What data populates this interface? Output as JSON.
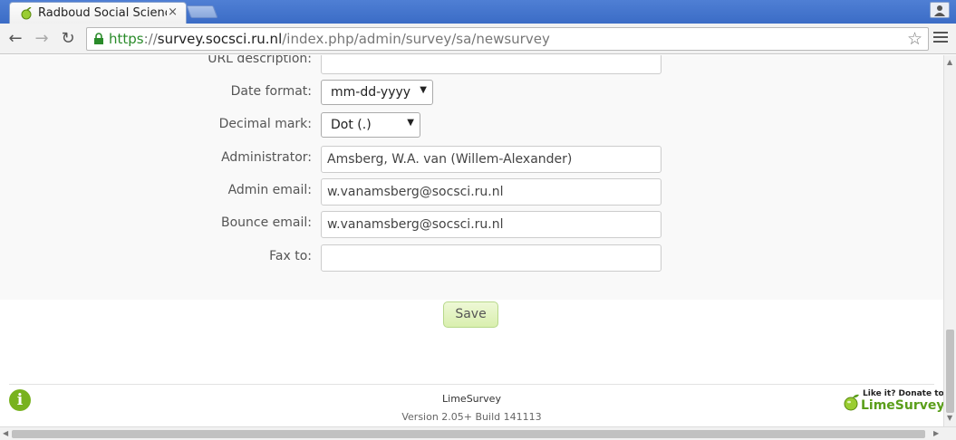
{
  "browser": {
    "tab_title": "Radboud Social Science",
    "tab_close": "×",
    "url_scheme": "https",
    "url_sep": "://",
    "url_host": "survey.socsci.ru.nl",
    "url_path": "/index.php/admin/survey/sa/newsurvey",
    "back_icon": "←",
    "forward_icon": "→",
    "reload_icon": "↻",
    "star_icon": "☆"
  },
  "form": {
    "url_description": {
      "label": "URL description:",
      "value": ""
    },
    "date_format": {
      "label": "Date format:",
      "value": "mm-dd-yyyy"
    },
    "decimal_mark": {
      "label": "Decimal mark:",
      "value": "Dot (.)"
    },
    "administrator": {
      "label": "Administrator:",
      "value": "Amsberg, W.A. van (Willem-Alexander)"
    },
    "admin_email": {
      "label": "Admin email:",
      "value": "w.vanamsberg@socsci.ru.nl"
    },
    "bounce_email": {
      "label": "Bounce email:",
      "value": "w.vanamsberg@socsci.ru.nl"
    },
    "fax_to": {
      "label": "Fax to:",
      "value": ""
    },
    "dropdown_arrow": "▼",
    "save_label": "Save"
  },
  "footer": {
    "name": "LimeSurvey",
    "version": "Version 2.05+ Build 141113",
    "info_icon_glyph": "i",
    "donate_line1": "Like it? Donate to",
    "donate_line2": "LimeSurvey"
  },
  "colors": {
    "accent_green": "#78b21f",
    "chrome_blue": "#3b6cc6"
  }
}
